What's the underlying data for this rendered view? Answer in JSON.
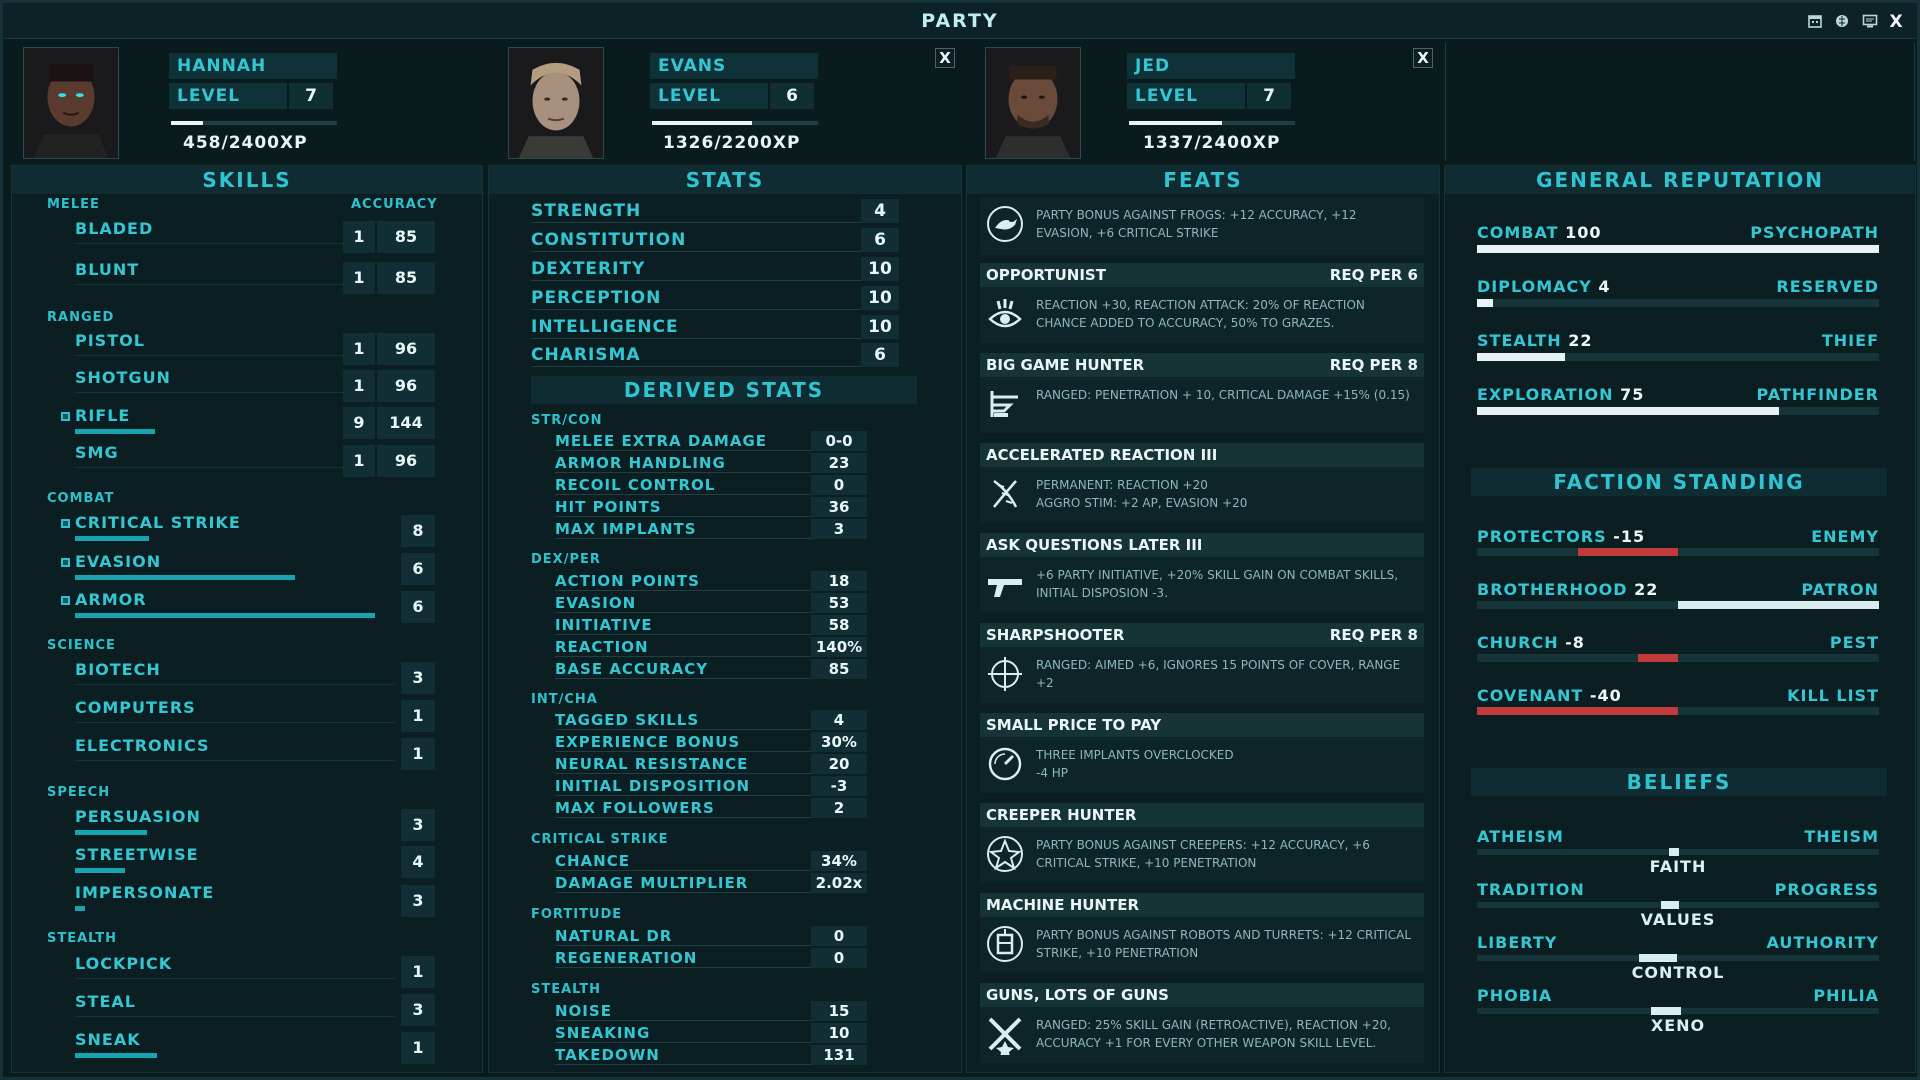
{
  "window": {
    "title": "PARTY",
    "icons": [
      "calendar-icon",
      "brain-icon",
      "monitor-icon",
      "close-icon"
    ],
    "close_label": "X"
  },
  "party": [
    {
      "name": "HANNAH",
      "level_label": "LEVEL",
      "level": "7",
      "xp": "458/2400XP",
      "xp_fraction": 0.19
    },
    {
      "name": "EVANS",
      "level_label": "LEVEL",
      "level": "6",
      "xp": "1326/2200XP",
      "xp_fraction": 0.6,
      "close": "X"
    },
    {
      "name": "JED",
      "level_label": "LEVEL",
      "level": "7",
      "xp": "1337/2400XP",
      "xp_fraction": 0.56,
      "close": "X"
    }
  ],
  "skills": {
    "title": "SKILLS",
    "accuracy_label": "ACCURACY",
    "categories": [
      {
        "name": "MELEE",
        "items": [
          {
            "name": "BLADED",
            "rank": "1",
            "accuracy": "85"
          },
          {
            "name": "BLUNT",
            "rank": "1",
            "accuracy": "85"
          }
        ]
      },
      {
        "name": "RANGED",
        "items": [
          {
            "name": "PISTOL",
            "rank": "1",
            "accuracy": "96"
          },
          {
            "name": "SHOTGUN",
            "rank": "1",
            "accuracy": "96"
          },
          {
            "name": "RIFLE",
            "rank": "9",
            "accuracy": "144",
            "tagged": true,
            "progress": 0.25
          },
          {
            "name": "SMG",
            "rank": "1",
            "accuracy": "96"
          }
        ]
      },
      {
        "name": "COMBAT",
        "items": [
          {
            "name": "CRITICAL STRIKE",
            "rank": "8",
            "tagged": true,
            "progress": 0.23
          },
          {
            "name": "EVASION",
            "rank": "6",
            "tagged": true,
            "progress": 0.7
          },
          {
            "name": "ARMOR",
            "rank": "6",
            "tagged": true,
            "progress": 0.96
          }
        ]
      },
      {
        "name": "SCIENCE",
        "items": [
          {
            "name": "BIOTECH",
            "rank": "3"
          },
          {
            "name": "COMPUTERS",
            "rank": "1"
          },
          {
            "name": "ELECTRONICS",
            "rank": "1"
          }
        ]
      },
      {
        "name": "SPEECH",
        "items": [
          {
            "name": "PERSUASION",
            "rank": "3",
            "progress": 0.23
          },
          {
            "name": "STREETWISE",
            "rank": "4",
            "progress": 0.15
          },
          {
            "name": "IMPERSONATE",
            "rank": "3",
            "progress": 0.03
          }
        ]
      },
      {
        "name": "STEALTH",
        "items": [
          {
            "name": "LOCKPICK",
            "rank": "1"
          },
          {
            "name": "STEAL",
            "rank": "3"
          },
          {
            "name": "SNEAK",
            "rank": "1",
            "progress": 0.26
          }
        ]
      }
    ]
  },
  "stats": {
    "title": "STATS",
    "items": [
      {
        "name": "STRENGTH",
        "value": "4"
      },
      {
        "name": "CONSTITUTION",
        "value": "6"
      },
      {
        "name": "DEXTERITY",
        "value": "10"
      },
      {
        "name": "PERCEPTION",
        "value": "10"
      },
      {
        "name": "INTELLIGENCE",
        "value": "10"
      },
      {
        "name": "CHARISMA",
        "value": "6"
      }
    ],
    "derived_title": "DERIVED STATS",
    "derived": [
      {
        "group": "STR/CON",
        "items": [
          {
            "name": "MELEE EXTRA DAMAGE",
            "value": "0-0"
          },
          {
            "name": "ARMOR HANDLING",
            "value": "23"
          },
          {
            "name": "RECOIL CONTROL",
            "value": "0"
          },
          {
            "name": "HIT POINTS",
            "value": "36"
          },
          {
            "name": "MAX IMPLANTS",
            "value": "3"
          }
        ]
      },
      {
        "group": "DEX/PER",
        "items": [
          {
            "name": "ACTION POINTS",
            "value": "18"
          },
          {
            "name": "EVASION",
            "value": "53"
          },
          {
            "name": "INITIATIVE",
            "value": "58"
          },
          {
            "name": "REACTION",
            "value": "140%"
          },
          {
            "name": "BASE ACCURACY",
            "value": "85"
          }
        ]
      },
      {
        "group": "INT/CHA",
        "items": [
          {
            "name": "TAGGED SKILLS",
            "value": "4"
          },
          {
            "name": "EXPERIENCE BONUS",
            "value": "30%"
          },
          {
            "name": "NEURAL RESISTANCE",
            "value": "20"
          },
          {
            "name": "INITIAL DISPOSITION",
            "value": "-3"
          },
          {
            "name": "MAX FOLLOWERS",
            "value": "2"
          }
        ]
      },
      {
        "group": "CRITICAL STRIKE",
        "items": [
          {
            "name": "CHANCE",
            "value": "34%"
          },
          {
            "name": "DAMAGE MULTIPLIER",
            "value": "2.02x"
          }
        ]
      },
      {
        "group": "FORTITUDE",
        "items": [
          {
            "name": "NATURAL DR",
            "value": "0"
          },
          {
            "name": "REGENERATION",
            "value": "0"
          }
        ]
      },
      {
        "group": "STEALTH",
        "items": [
          {
            "name": "NOISE",
            "value": "15"
          },
          {
            "name": "SNEAKING",
            "value": "10"
          },
          {
            "name": "TAKEDOWN",
            "value": "131"
          }
        ]
      }
    ]
  },
  "feats": {
    "title": "FEATS",
    "items": [
      {
        "name": "",
        "req": "",
        "icon": "frog-icon",
        "desc": "PARTY BONUS AGAINST FROGS: +12 ACCURACY, +12 EVASION, +6 CRITICAL STRIKE"
      },
      {
        "name": "OPPORTUNIST",
        "req": "REQ PER 6",
        "icon": "eye-icon",
        "desc": "REACTION +30, REACTION ATTACK: 20% OF REACTION CHANCE ADDED TO ACCURACY, 50% TO GRAZES."
      },
      {
        "name": "BIG GAME HUNTER",
        "req": "REQ PER 8",
        "icon": "rifle-icon",
        "desc": "RANGED: PENETRATION + 10, CRITICAL DAMAGE +15% (0.15)"
      },
      {
        "name": "ACCELERATED REACTION III",
        "req": "",
        "icon": "dna-icon",
        "desc": "PERMANENT: REACTION +20\nAGGRO STIM: +2 AP, EVASION +20"
      },
      {
        "name": "ASK QUESTIONS LATER III",
        "req": "",
        "icon": "pistol-icon",
        "desc": "+6 PARTY INITIATIVE, +20% SKILL GAIN ON COMBAT SKILLS, INITIAL DISPOSION -3."
      },
      {
        "name": "SHARPSHOOTER",
        "req": "REQ PER 8",
        "icon": "crosshair-icon",
        "desc": "RANGED: AIMED +6, IGNORES 15 POINTS OF COVER, RANGE +2"
      },
      {
        "name": "SMALL PRICE TO PAY",
        "req": "",
        "icon": "gauge-icon",
        "desc": "THREE IMPLANTS OVERCLOCKED\n-4 HP"
      },
      {
        "name": "CREEPER HUNTER",
        "req": "",
        "icon": "creeper-icon",
        "desc": "PARTY BONUS AGAINST CREEPERS: +12 ACCURACY, +6 CRITICAL STRIKE, +10 PENETRATION"
      },
      {
        "name": "MACHINE HUNTER",
        "req": "",
        "icon": "robot-icon",
        "desc": "PARTY BONUS AGAINST ROBOTS AND TURRETS: +12 CRITICAL STRIKE, +10 PENETRATION"
      },
      {
        "name": "GUNS, LOTS OF GUNS",
        "req": "",
        "icon": "crossed-guns-icon",
        "desc": "RANGED: 25% SKILL GAIN (RETROACTIVE), REACTION +20, ACCURACY +1 FOR EVERY OTHER WEAPON SKILL LEVEL."
      }
    ]
  },
  "reputation": {
    "title": "GENERAL REPUTATION",
    "items": [
      {
        "name": "COMBAT",
        "value": "100",
        "rank": "PSYCHOPATH",
        "fraction": 1.0
      },
      {
        "name": "DIPLOMACY",
        "value": "4",
        "rank": "RESERVED",
        "fraction": 0.04
      },
      {
        "name": "STEALTH",
        "value": "22",
        "rank": "THIEF",
        "fraction": 0.22
      },
      {
        "name": "EXPLORATION",
        "value": "75",
        "rank": "PATHFINDER",
        "fraction": 0.75
      }
    ],
    "faction_title": "FACTION STANDING",
    "factions": [
      {
        "name": "PROTECTORS",
        "value": "-15",
        "rank": "ENEMY",
        "fraction": -0.5
      },
      {
        "name": "BROTHERHOOD",
        "value": "22",
        "rank": "PATRON",
        "fraction": 1.0
      },
      {
        "name": "CHURCH",
        "value": "-8",
        "rank": "PEST",
        "fraction": -0.2
      },
      {
        "name": "COVENANT",
        "value": "-40",
        "rank": "KILL LIST",
        "fraction": -1.0
      }
    ],
    "colors": {
      "positive": "#d8ecef",
      "negative": "#c33a3c",
      "bar": "#e6f2f3"
    }
  },
  "beliefs": {
    "title": "BELIEFS",
    "items": [
      {
        "left": "ATHEISM",
        "right": "THEISM",
        "name": "FAITH",
        "position": 0.49
      },
      {
        "left": "TRADITION",
        "right": "PROGRESS",
        "name": "VALUES",
        "position": 0.48
      },
      {
        "left": "LIBERTY",
        "right": "AUTHORITY",
        "name": "CONTROL",
        "position": 0.45
      },
      {
        "left": "PHOBIA",
        "right": "PHILIA",
        "name": "XENO",
        "position": 0.47
      }
    ]
  }
}
